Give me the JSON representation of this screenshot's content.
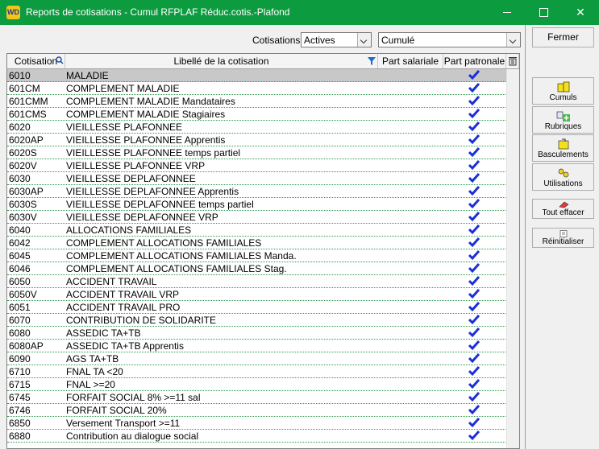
{
  "window": {
    "title": "Reports de cotisations - Cumul RFPLAF Réduc.cotis.-Plafond",
    "app_icon_text": "WD"
  },
  "filter": {
    "label": "Cotisations",
    "status_value": "Actives",
    "mode_value": "Cumulé"
  },
  "grid": {
    "headers": {
      "code": "Cotisation",
      "label": "Libellé de la cotisation",
      "salariale": "Part salariale",
      "patronale": "Part patronale"
    },
    "rows": [
      {
        "code": "6010",
        "label": "MALADIE",
        "patronale": true
      },
      {
        "code": "601CM",
        "label": "COMPLEMENT MALADIE",
        "patronale": true
      },
      {
        "code": "601CMM",
        "label": "COMPLEMENT MALADIE Mandataires",
        "patronale": true
      },
      {
        "code": "601CMS",
        "label": "COMPLEMENT MALADIE Stagiaires",
        "patronale": true
      },
      {
        "code": "6020",
        "label": "VIEILLESSE PLAFONNEE",
        "patronale": true
      },
      {
        "code": "6020AP",
        "label": "VIEILLESSE PLAFONNEE Apprentis",
        "patronale": true
      },
      {
        "code": "6020S",
        "label": "VIEILLESSE PLAFONNEE temps partiel",
        "patronale": true
      },
      {
        "code": "6020V",
        "label": "VIEILLESSE PLAFONNEE VRP",
        "patronale": true
      },
      {
        "code": "6030",
        "label": "VIEILLESSE DEPLAFONNEE",
        "patronale": true
      },
      {
        "code": "6030AP",
        "label": "VIEILLESSE DEPLAFONNEE Apprentis",
        "patronale": true
      },
      {
        "code": "6030S",
        "label": "VIEILLESSE DEPLAFONNEE temps partiel",
        "patronale": true
      },
      {
        "code": "6030V",
        "label": "VIEILLESSE DEPLAFONNEE VRP",
        "patronale": true
      },
      {
        "code": "6040",
        "label": "ALLOCATIONS FAMILIALES",
        "patronale": true
      },
      {
        "code": "6042",
        "label": "COMPLEMENT ALLOCATIONS FAMILIALES",
        "patronale": true
      },
      {
        "code": "6045",
        "label": "COMPLEMENT ALLOCATIONS FAMILIALES Manda.",
        "patronale": true
      },
      {
        "code": "6046",
        "label": "COMPLEMENT ALLOCATIONS FAMILIALES Stag.",
        "patronale": true
      },
      {
        "code": "6050",
        "label": "ACCIDENT TRAVAIL",
        "patronale": true
      },
      {
        "code": "6050V",
        "label": "ACCIDENT TRAVAIL VRP",
        "patronale": true
      },
      {
        "code": "6051",
        "label": "ACCIDENT TRAVAIL PRO",
        "patronale": true
      },
      {
        "code": "6070",
        "label": "CONTRIBUTION DE SOLIDARITE",
        "patronale": true
      },
      {
        "code": "6080",
        "label": "ASSEDIC TA+TB",
        "patronale": true
      },
      {
        "code": "6080AP",
        "label": "ASSEDIC TA+TB Apprentis",
        "patronale": true
      },
      {
        "code": "6090",
        "label": "AGS TA+TB",
        "patronale": true
      },
      {
        "code": "6710",
        "label": "FNAL TA <20",
        "patronale": true
      },
      {
        "code": "6715",
        "label": "FNAL >=20",
        "patronale": true
      },
      {
        "code": "6745",
        "label": "FORFAIT SOCIAL 8% >=11 sal",
        "patronale": true
      },
      {
        "code": "6746",
        "label": "FORFAIT SOCIAL 20%",
        "patronale": true
      },
      {
        "code": "6850",
        "label": "Versement Transport >=11",
        "patronale": true
      },
      {
        "code": "6880",
        "label": "Contribution au dialogue social",
        "patronale": true
      }
    ]
  },
  "buttons": {
    "fermer": "Fermer",
    "cumuls": "Cumuls",
    "rubriques": "Rubriques",
    "basculements": "Basculements",
    "utilisations": "Utilisations",
    "tout_effacer": "Tout effacer",
    "reinitialiser": "Réinitialiser"
  },
  "colors": {
    "titlebar": "#0d9b3f",
    "check": "#1d2fd6",
    "row_separator": "#2a9a4a",
    "selected_row": "#c8c8c8"
  }
}
